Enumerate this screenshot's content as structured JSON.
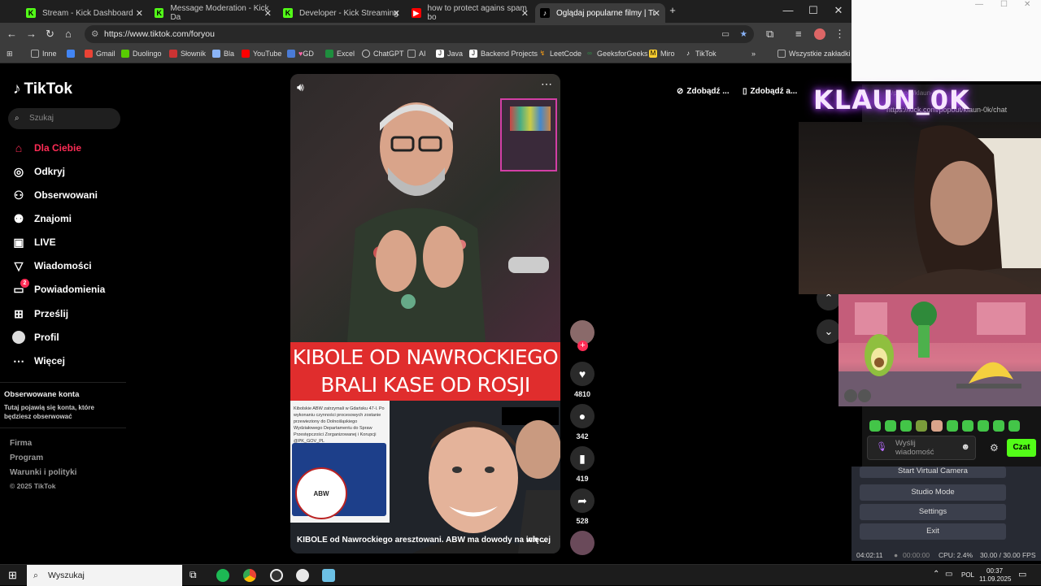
{
  "tabs": [
    {
      "title": "Stream - Kick Dashboard",
      "fav": "K",
      "color": "#53fc18"
    },
    {
      "title": "Message Moderation - Kick Da",
      "fav": "K",
      "color": "#53fc18"
    },
    {
      "title": "Developer - Kick Streaming",
      "fav": "K",
      "color": "#53fc18"
    },
    {
      "title": "how to protect agains spam bo",
      "fav": "▶",
      "color": "#ff0000"
    },
    {
      "title": "Oglądaj popularne filmy | Ti",
      "fav": "♪",
      "color": "#000000"
    }
  ],
  "address": {
    "url": "https://www.tiktok.com/foryou"
  },
  "bookmarks": [
    "Inne",
    "Gmail",
    "Duolingo",
    "Słownik",
    "Bla",
    "YouTube",
    "GD",
    "Excel",
    "ChatGPT",
    "AI",
    "Java",
    "Backend Projects",
    "LeetCode",
    "GeeksforGeeks",
    "Miro",
    "TikTok",
    "Wszystkie zakładki"
  ],
  "sidebar": {
    "logo": "TikTok",
    "search_placeholder": "Szukaj",
    "items": [
      {
        "label": "Dla Ciebie",
        "icon": "home-icon"
      },
      {
        "label": "Odkryj",
        "icon": "compass-icon"
      },
      {
        "label": "Obserwowani",
        "icon": "following-icon"
      },
      {
        "label": "Znajomi",
        "icon": "friends-icon"
      },
      {
        "label": "LIVE",
        "icon": "live-icon"
      },
      {
        "label": "Wiadomości",
        "icon": "messages-icon"
      },
      {
        "label": "Powiadomienia",
        "icon": "notifications-icon",
        "badge": "2"
      },
      {
        "label": "Prześlij",
        "icon": "upload-icon"
      },
      {
        "label": "Profil",
        "icon": "profile-icon"
      },
      {
        "label": "Więcej",
        "icon": "more-icon"
      }
    ],
    "followed_title": "Obserwowane konta",
    "followed_desc": "Tutaj pojawią się konta, które będziesz obserwować",
    "footer": [
      "Firma",
      "Program",
      "Warunki i polityki",
      "© 2025 TikTok"
    ]
  },
  "video": {
    "headline_line1": "KIBOLE OD NAWROCKIEGO",
    "headline_line2": "BRALI KASE OD ROSJI",
    "caption": "KIBOLE od Nawrockiego aresztowani. ABW ma dowody na ich ...",
    "more_label": "więcej",
    "doc_text": "Kibolskie ABW zatrzymali w Gdańsku 47-l. Po wykonaniu czynności procesowych zostanie przewieziony do Dolnośląskiego Wydziałowego Departamentu do Spraw Przestępczości Zorganizowanej i Korupcji @PK_GOV_PL",
    "seal_label": "ABW"
  },
  "actions": {
    "likes": "4810",
    "comments": "342",
    "saves": "419",
    "shares": "528"
  },
  "pills": {
    "get1": "Zdobądź ...",
    "get2": "Zdobądź a..."
  },
  "overlay": {
    "logo": "KLAUN_0K",
    "popout_url": "https://kick.com/popout/klaun-0k/chat",
    "popout_url2": "/popout/klaun-0k"
  },
  "chat": {
    "placeholder": "Wyślij wiadomość",
    "button": "Czat"
  },
  "obs": {
    "buttons": [
      "Start Virtual Camera",
      "Studio Mode",
      "Settings",
      "Exit"
    ],
    "timer": "04:02:11",
    "rec": "00:00:00",
    "cpu": "CPU: 2.4%",
    "fps": "30.00 / 30.00 FPS"
  },
  "taskbar": {
    "search": "Wyszukaj",
    "lang": "POL",
    "time": "00:37",
    "date": "11.09.2025"
  },
  "colors": {
    "accent": "#fe2c55",
    "kick": "#53fc18",
    "band": "#e02d2d"
  }
}
